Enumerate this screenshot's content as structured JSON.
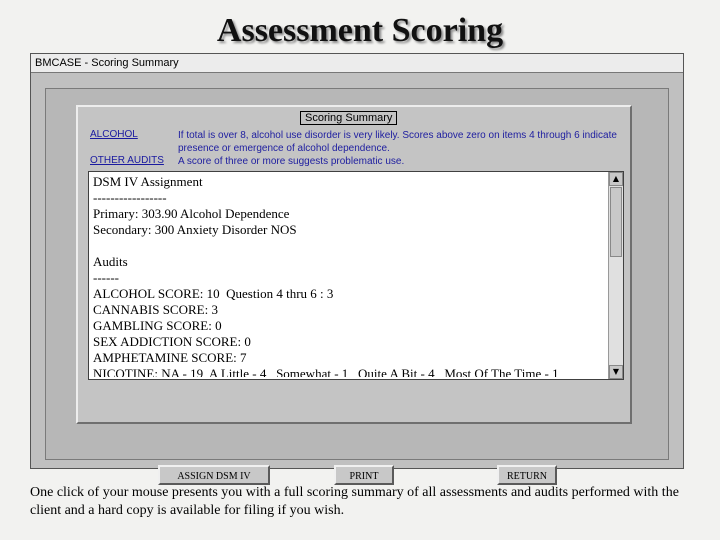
{
  "slide": {
    "title": "Assessment Scoring",
    "caption": "One click of your mouse presents you with a full scoring summary of all assessments and audits performed with the client and a hard copy is available for filing if you wish."
  },
  "window": {
    "title": "BMCASE - Scoring Summary",
    "group_label": "Scoring Summary",
    "audits": [
      {
        "label": "ALCOHOL",
        "description": "If total is over 8, alcohol use disorder is very likely. Scores above zero on items 4 through 6 indicate presence or emergence of alcohol dependence."
      },
      {
        "label": "OTHER AUDITS",
        "description": "A score of three or more suggests problematic use."
      }
    ],
    "summary_lines": [
      "DSM IV Assignment",
      "-----------------",
      "Primary: 303.90 Alcohol Dependence",
      "Secondary: 300 Anxiety Disorder NOS",
      "",
      "Audits",
      "------",
      "ALCOHOL SCORE: 10  Question 4 thru 6 : 3",
      "CANNABIS SCORE: 3",
      "GAMBLING SCORE: 0",
      "SEX ADDICTION SCORE: 0",
      "AMPHETAMINE SCORE: 7",
      "NICOTINE: NA - 19  A Little - 4   Somewhat - 1   Quite A Bit - 4   Most Of The Time - 1"
    ],
    "buttons": {
      "assign": "ASSIGN DSM IV",
      "print": "PRINT",
      "return": "RETURN"
    },
    "scroll_up": "▲",
    "scroll_down": "▼"
  }
}
